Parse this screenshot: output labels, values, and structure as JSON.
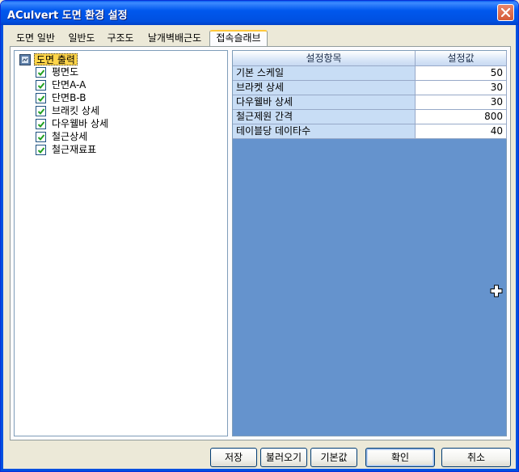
{
  "window": {
    "title": "ACulvert 도면 환경 설정"
  },
  "tabs": [
    {
      "label": "도면 일반"
    },
    {
      "label": "일반도"
    },
    {
      "label": "구조도"
    },
    {
      "label": "날개벽배근도"
    },
    {
      "label": "접속슬래브"
    }
  ],
  "tree": {
    "root_label": "도면 출력",
    "items": [
      {
        "label": "평면도",
        "checked": true
      },
      {
        "label": "단면A-A",
        "checked": true
      },
      {
        "label": "단면B-B",
        "checked": true
      },
      {
        "label": "브래킷 상세",
        "checked": true
      },
      {
        "label": "다우웰바 상세",
        "checked": true
      },
      {
        "label": "철근상세",
        "checked": true
      },
      {
        "label": "철근재료표",
        "checked": true
      }
    ]
  },
  "grid": {
    "headers": {
      "name": "설정항목",
      "value": "설정값"
    },
    "rows": [
      {
        "name": "기본 스케일",
        "value": "50"
      },
      {
        "name": "브라켓 상세",
        "value": "30"
      },
      {
        "name": "다우웰바 상세",
        "value": "30"
      },
      {
        "name": "철근제원 간격",
        "value": "800"
      },
      {
        "name": "테이블당 데이타수",
        "value": "40"
      }
    ]
  },
  "buttons": {
    "save": "저장",
    "load": "불러오기",
    "default": "기본값",
    "ok": "확인",
    "cancel": "취소"
  },
  "colors": {
    "titlebar": "#0058EE",
    "grid_background": "#6593CD",
    "active_tab_accent": "#FFC83C",
    "checkbox_check": "#21A121"
  }
}
